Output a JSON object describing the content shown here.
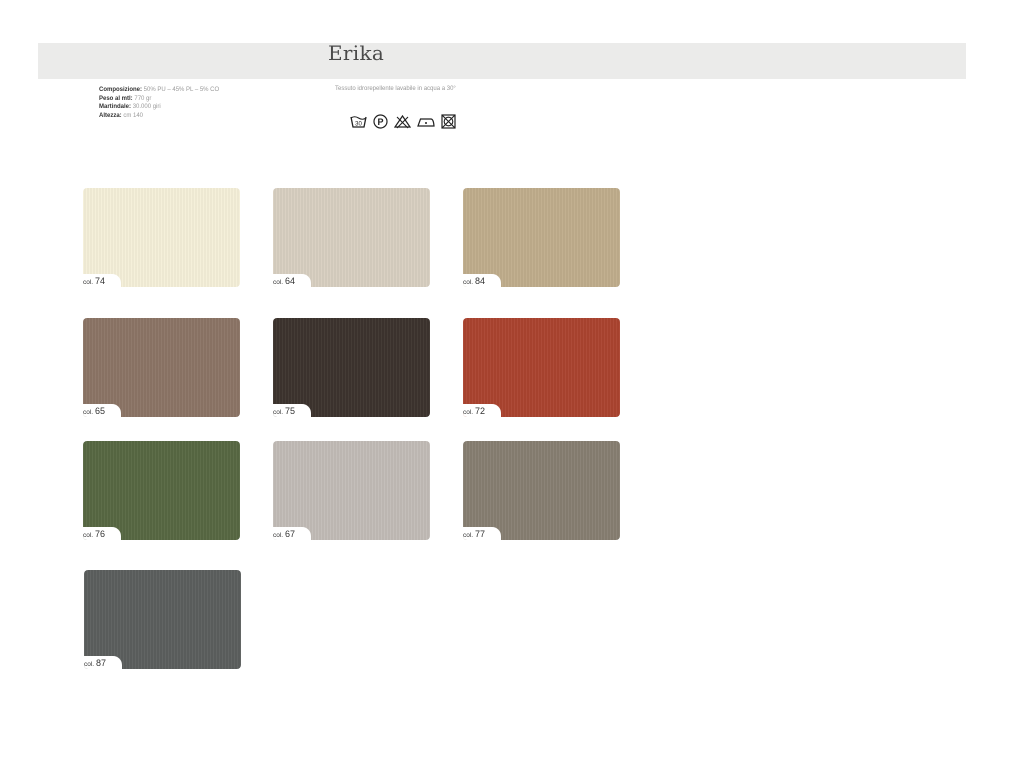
{
  "title": "Erika",
  "specs": [
    {
      "key": "Composizione:",
      "value": "50% PU – 45% PL – 5% CO"
    },
    {
      "key": "Peso al mtl:",
      "value": "770 gr"
    },
    {
      "key": "Martindale:",
      "value": "30.000 giri"
    },
    {
      "key": "Altezza:",
      "value": "cm 140"
    }
  ],
  "care_text": "Tessuto idrorepellente lavabile in acqua a 30°",
  "care_icons": [
    "wash-30-icon",
    "dry-clean-p-icon",
    "no-bleach-icon",
    "iron-low-icon",
    "no-tumble-dry-icon"
  ],
  "swatches": [
    {
      "prefix": "col.",
      "code": "74",
      "color": "#f5efd9"
    },
    {
      "prefix": "col.",
      "code": "64",
      "color": "#d8cfc1"
    },
    {
      "prefix": "col.",
      "code": "84",
      "color": "#c0ad8c"
    },
    {
      "prefix": "col.",
      "code": "65",
      "color": "#8c7566"
    },
    {
      "prefix": "col.",
      "code": "75",
      "color": "#3d342e"
    },
    {
      "prefix": "col.",
      "code": "72",
      "color": "#ab4430"
    },
    {
      "prefix": "col.",
      "code": "76",
      "color": "#586843"
    },
    {
      "prefix": "col.",
      "code": "67",
      "color": "#c2bcb7"
    },
    {
      "prefix": "col.",
      "code": "77",
      "color": "#877f72"
    },
    {
      "prefix": "col.",
      "code": "87",
      "color": "#5c5f5e"
    }
  ]
}
